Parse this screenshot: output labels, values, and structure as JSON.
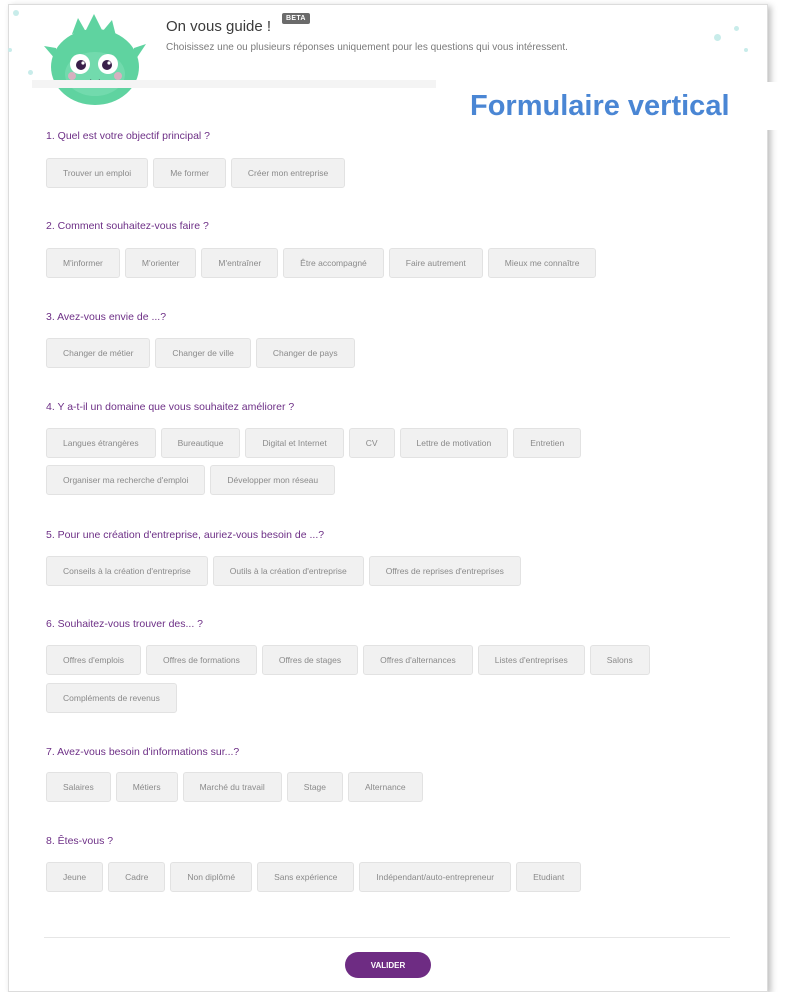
{
  "header": {
    "title": "On vous guide !",
    "badge": "BETA",
    "subtitle": "Choisissez une ou plusieurs réponses uniquement pour les questions qui vous intéressent."
  },
  "overlay_label": "Formulaire vertical",
  "questions": [
    {
      "title": "1. Quel est votre objectif principal ?",
      "options": [
        "Trouver un emploi",
        "Me former",
        "Créer mon entreprise"
      ]
    },
    {
      "title": "2. Comment souhaitez-vous faire ?",
      "options": [
        "M'informer",
        "M'orienter",
        "M'entraîner",
        "Être accompagné",
        "Faire autrement",
        "Mieux me connaître"
      ]
    },
    {
      "title": "3. Avez-vous envie de ...?",
      "options": [
        "Changer de métier",
        "Changer de ville",
        "Changer de pays"
      ]
    },
    {
      "title": "4. Y a-t-il un domaine que vous souhaitez améliorer ?",
      "options": [
        "Langues étrangères",
        "Bureautique",
        "Digital et Internet",
        "CV",
        "Lettre de motivation",
        "Entretien",
        "Organiser ma recherche d'emploi",
        "Développer mon réseau"
      ]
    },
    {
      "title": "5. Pour une création d'entreprise, auriez-vous besoin de ...?",
      "options": [
        "Conseils à la création d'entreprise",
        "Outils à la création d'entreprise",
        "Offres de reprises d'entreprises"
      ]
    },
    {
      "title": "6. Souhaitez-vous trouver des... ?",
      "options": [
        "Offres d'emplois",
        "Offres de formations",
        "Offres de stages",
        "Offres d'alternances",
        "Listes d'entreprises",
        "Salons",
        "Compléments de revenus"
      ]
    },
    {
      "title": "7. Avez-vous besoin d'informations sur...?",
      "options": [
        "Salaires",
        "Métiers",
        "Marché du travail",
        "Stage",
        "Alternance"
      ]
    },
    {
      "title": "8. Êtes-vous ?",
      "options": [
        "Jeune",
        "Cadre",
        "Non diplômé",
        "Sans expérience",
        "Indépendant/auto-entrepreneur",
        "Etudiant"
      ]
    }
  ],
  "footer": {
    "validate_label": "VALIDER"
  },
  "colors": {
    "accent": "#6e2c83",
    "overlay_text": "#4a86d4",
    "mascot": "#5fd3a0"
  }
}
